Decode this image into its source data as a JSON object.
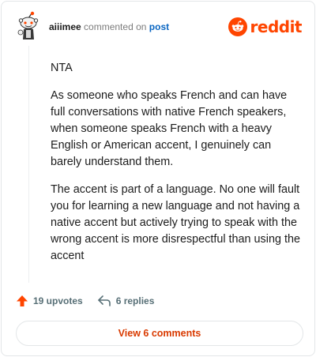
{
  "header": {
    "username": "aiiimee",
    "verb": "commented on",
    "post_link": "post",
    "brand": "reddit"
  },
  "comment": {
    "paragraphs": [
      "NTA",
      "As someone who speaks French and can have full conversations with native French speakers, when someone speaks French with a heavy English or American accent, I genuinely can barely understand them.",
      "The accent is part of a language. No one will fault you for learning a new language and not having a native accent but actively trying to speak with the wrong accent is more disrespectful than using the accent"
    ]
  },
  "actions": {
    "upvotes": "19 upvotes",
    "replies": "6 replies"
  },
  "footer": {
    "view_comments": "View 6 comments"
  },
  "colors": {
    "brand": "#ff4500",
    "link": "#0a66c2",
    "view_button_text": "#d93a00"
  },
  "icons": {
    "avatar": "snoo-avatar",
    "brand": "reddit-logo-icon",
    "upvote": "upvote-arrow-icon",
    "reply": "reply-arrow-icon"
  }
}
